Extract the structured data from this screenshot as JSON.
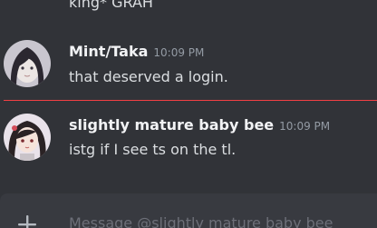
{
  "previous_message": {
    "text": "king* GRAH"
  },
  "messages": [
    {
      "username": "Mint/Taka",
      "timestamp": "10:09 PM",
      "text": "that deserved a login."
    },
    {
      "username": "slightly mature baby bee",
      "timestamp": "10:09 PM",
      "text": "istg if I see ts on the tl."
    }
  ],
  "composer": {
    "placeholder": "Message @slightly mature baby bee"
  },
  "colors": {
    "background": "#313338",
    "new_messages_divider": "#f23f43",
    "composer_background": "#383a40"
  }
}
